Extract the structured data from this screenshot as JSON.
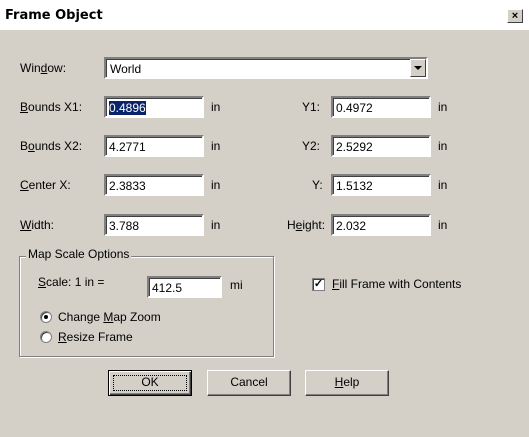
{
  "title": "Frame Object",
  "window_label": {
    "pre": "Win",
    "key": "d",
    "post": "ow:"
  },
  "window_value": "World",
  "bounds_x1": {
    "label": {
      "pre": "",
      "key": "B",
      "post": "ounds X1:"
    },
    "value": "0.4896",
    "unit": "in"
  },
  "y1": {
    "label": "Y1:",
    "value": "0.4972",
    "unit": "in"
  },
  "bounds_x2": {
    "label": {
      "pre": "B",
      "key": "o",
      "post": "unds X2:"
    },
    "value": "4.2771",
    "unit": "in"
  },
  "y2": {
    "label": "Y2:",
    "value": "2.5292",
    "unit": "in"
  },
  "center_x": {
    "label": {
      "pre": "",
      "key": "C",
      "post": "enter X:"
    },
    "value": "2.3833",
    "unit": "in"
  },
  "center_y": {
    "label": "Y:",
    "value": "1.5132",
    "unit": "in"
  },
  "width": {
    "label": {
      "pre": "",
      "key": "W",
      "post": "idth:"
    },
    "value": "3.788",
    "unit": "in"
  },
  "height": {
    "label": {
      "pre": "H",
      "key": "e",
      "post": "ight:"
    },
    "value": "2.032",
    "unit": "in"
  },
  "map_scale": {
    "group_title": "Map Scale Options",
    "scale_label": {
      "pre": "",
      "key": "S",
      "post": "cale: 1 in ="
    },
    "scale_value": "412.5",
    "scale_unit": "mi",
    "change_zoom": {
      "pre": "Change ",
      "key": "M",
      "post": "ap Zoom",
      "selected": true
    },
    "resize_frame": {
      "pre": "",
      "key": "R",
      "post": "esize Frame",
      "selected": false
    }
  },
  "fill_frame": {
    "pre": "",
    "key": "F",
    "post": "ill Frame with Contents",
    "checked": true
  },
  "buttons": {
    "ok": "OK",
    "cancel": "Cancel",
    "help": {
      "pre": "",
      "key": "H",
      "post": "elp"
    }
  },
  "icons": {
    "close": "×",
    "check": "✓"
  }
}
